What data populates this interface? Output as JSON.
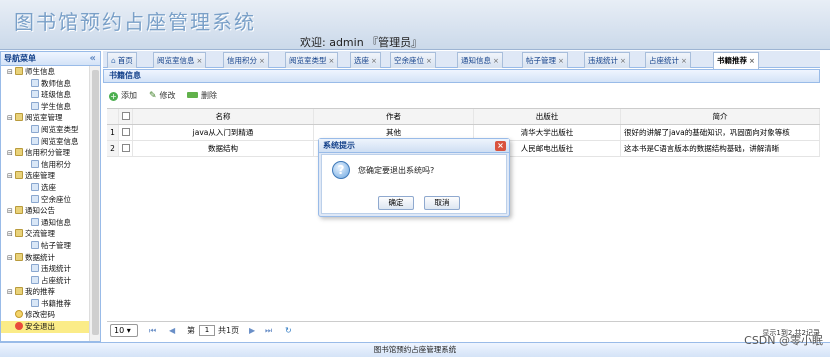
{
  "header": {
    "app_title": "图书馆预约占座管理系统",
    "welcome": "欢迎: admin 『管理员』"
  },
  "sidebar": {
    "title": "导航菜单",
    "collapse": "«",
    "items": [
      {
        "label": "师生信息",
        "type": "folder",
        "level": 0
      },
      {
        "label": "教师信息",
        "type": "leaf",
        "level": 1
      },
      {
        "label": "班级信息",
        "type": "leaf",
        "level": 1
      },
      {
        "label": "学生信息",
        "type": "leaf",
        "level": 1
      },
      {
        "label": "阅览室管理",
        "type": "folder",
        "level": 0
      },
      {
        "label": "阅览室类型",
        "type": "leaf",
        "level": 1
      },
      {
        "label": "阅览室信息",
        "type": "leaf",
        "level": 1
      },
      {
        "label": "信用积分管理",
        "type": "folder",
        "level": 0
      },
      {
        "label": "信用积分",
        "type": "leaf",
        "level": 1
      },
      {
        "label": "选座管理",
        "type": "folder",
        "level": 0
      },
      {
        "label": "选座",
        "type": "leaf",
        "level": 1
      },
      {
        "label": "空余座位",
        "type": "leaf",
        "level": 1
      },
      {
        "label": "通知公告",
        "type": "folder",
        "level": 0
      },
      {
        "label": "通知信息",
        "type": "leaf",
        "level": 1
      },
      {
        "label": "交流管理",
        "type": "folder",
        "level": 0
      },
      {
        "label": "帖子管理",
        "type": "leaf",
        "level": 1
      },
      {
        "label": "数据统计",
        "type": "folder",
        "level": 0
      },
      {
        "label": "违规统计",
        "type": "leaf",
        "level": 1
      },
      {
        "label": "占座统计",
        "type": "leaf",
        "level": 1
      },
      {
        "label": "我的推荐",
        "type": "folder",
        "level": 0
      },
      {
        "label": "书籍推荐",
        "type": "leaf",
        "level": 1
      },
      {
        "label": "修改密码",
        "type": "pwd",
        "level": 0
      },
      {
        "label": "安全退出",
        "type": "exit",
        "level": 0
      }
    ]
  },
  "tabs": [
    {
      "label": "首页",
      "closable": false,
      "home": true
    },
    {
      "label": "阅览室信息",
      "closable": true
    },
    {
      "label": "信用积分",
      "closable": true
    },
    {
      "label": "阅览室类型",
      "closable": true
    },
    {
      "label": "选座",
      "closable": true
    },
    {
      "label": "空余座位",
      "closable": true
    },
    {
      "label": "通知信息",
      "closable": true
    },
    {
      "label": "帖子管理",
      "closable": true
    },
    {
      "label": "违规统计",
      "closable": true
    },
    {
      "label": "占座统计",
      "closable": true
    },
    {
      "label": "书籍推荐",
      "closable": true,
      "active": true
    }
  ],
  "tab_close": "×",
  "panel": {
    "title": "书籍信息",
    "toolbar": {
      "add": "添加",
      "edit": "修改",
      "delete": "删除"
    }
  },
  "grid": {
    "columns": [
      "名称",
      "作者",
      "出版社",
      "简介"
    ],
    "rows": [
      {
        "num": "1",
        "name": "java从入门到精通",
        "author": "其他",
        "publisher": "清华大学出版社",
        "intro": "很好的讲解了java的基础知识，巩固面向对象等核"
      },
      {
        "num": "2",
        "name": "数据结构",
        "author": "",
        "publisher": "人民邮电出版社",
        "intro": "这本书是C语言版本的数据结构基础，讲解清晰"
      }
    ]
  },
  "pager": {
    "page_size": "10",
    "page_prefix": "第",
    "page_value": "1",
    "page_suffix": "共1页",
    "info": "显示1到2,共2记录"
  },
  "footer": "图书馆预约占座管理系统",
  "watermark": "CSDN @零小眠",
  "dialog": {
    "title": "系统提示",
    "message": "您确定要退出系统吗?",
    "ok": "确定",
    "cancel": "取消",
    "close": "×",
    "icon": "?"
  }
}
